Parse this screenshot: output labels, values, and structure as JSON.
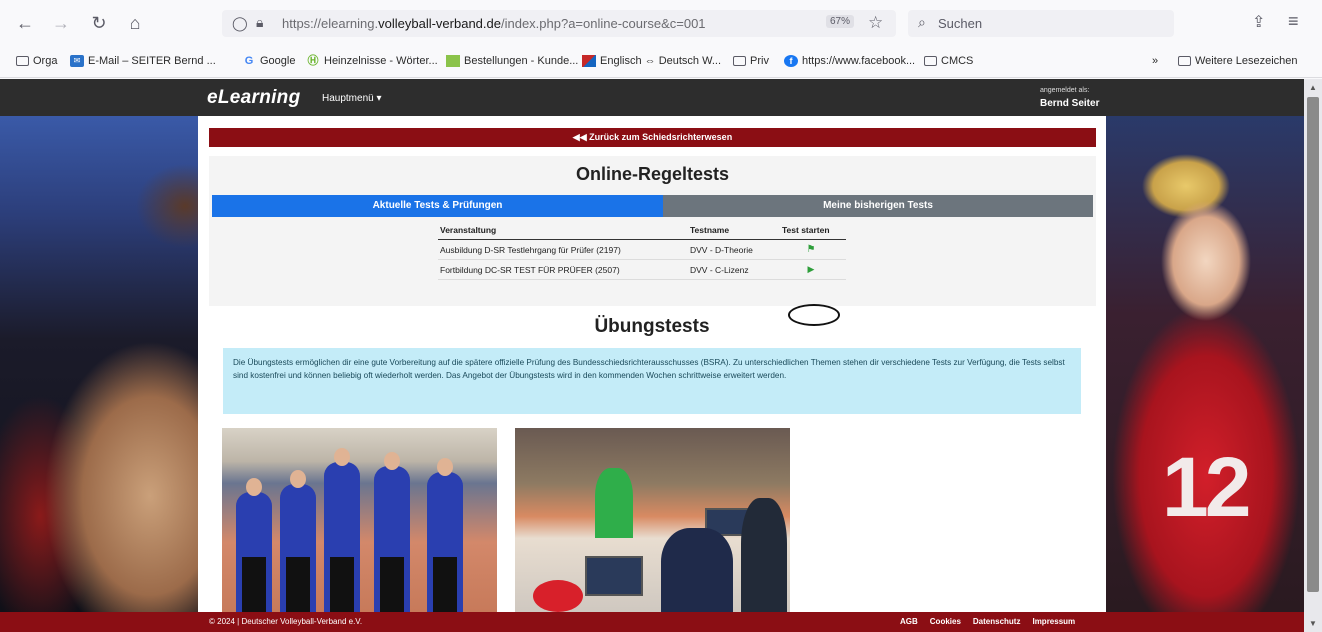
{
  "browser": {
    "url_prefix": "https://elearning.",
    "url_domain": "volleyball-verband.de",
    "url_suffix": "/index.php?a=online-course&c=001",
    "zoom": "67%",
    "search_placeholder": "Suchen"
  },
  "bookmarks": [
    {
      "label": "Orga",
      "icon": "folder-icon"
    },
    {
      "label": "E-Mail – SEITER Bernd ...",
      "icon": "mail-icon"
    },
    {
      "label": "Google",
      "icon": "google-icon"
    },
    {
      "label": "Heinzelnisse - Wörter...",
      "icon": "heinzelnisse-icon"
    },
    {
      "label": "Bestellungen - Kunde...",
      "icon": "list-icon"
    },
    {
      "label": "Englisch ⇔ Deutsch W...",
      "icon": "flag-icon"
    },
    {
      "label": "Priv",
      "icon": "folder-icon"
    },
    {
      "label": "https://www.facebook...",
      "icon": "facebook-icon"
    },
    {
      "label": "CMCS",
      "icon": "folder-icon"
    },
    {
      "label": "Weitere Lesezeichen",
      "icon": "folder-icon"
    }
  ],
  "site": {
    "logo": "eLearning",
    "main_menu": "Hauptmenü ▾",
    "login_label": "angemeldet als:",
    "login_user": "Bernd Seiter",
    "back_link": "◀◀ Zurück zum Schiedsrichterwesen",
    "title_online": "Online-Regeltests",
    "tabs": [
      "Aktuelle Tests & Prüfungen",
      "Meine bisherigen Tests"
    ],
    "table_headers": [
      "Veranstaltung",
      "Testname",
      "Test starten"
    ],
    "table_rows": [
      {
        "veranstaltung": "Ausbildung D-SR Testlehrgang für Prüfer (2197)",
        "testname": "DVV - D-Theorie",
        "action_icon": "flag-icon"
      },
      {
        "veranstaltung": "Fortbildung DC-SR TEST FÜR PRÜFER (2507)",
        "testname": "DVV - C-Lizenz",
        "action_icon": "play-icon"
      }
    ],
    "title_uebung": "Übungstests",
    "info_text": "Die Übungstests ermöglichen dir eine gute Vorbereitung auf die spätere offizielle Prüfung des Bundesschiedsrichterausschusses (BSRA). Zu unterschiedlichen Themen stehen dir verschiedene Tests zur Verfügung, die Tests selbst sind kostenfrei und können beliebig oft wiederholt werden. Das Angebot der Übungstests wird in den kommenden Wochen schrittweise erweitert werden.",
    "copyright": "© 2024 | Deutscher Volleyball-Verband e.V.",
    "footer_links": [
      "AGB",
      "Cookies",
      "Datenschutz",
      "Impressum"
    ],
    "jersey_number": "12"
  }
}
